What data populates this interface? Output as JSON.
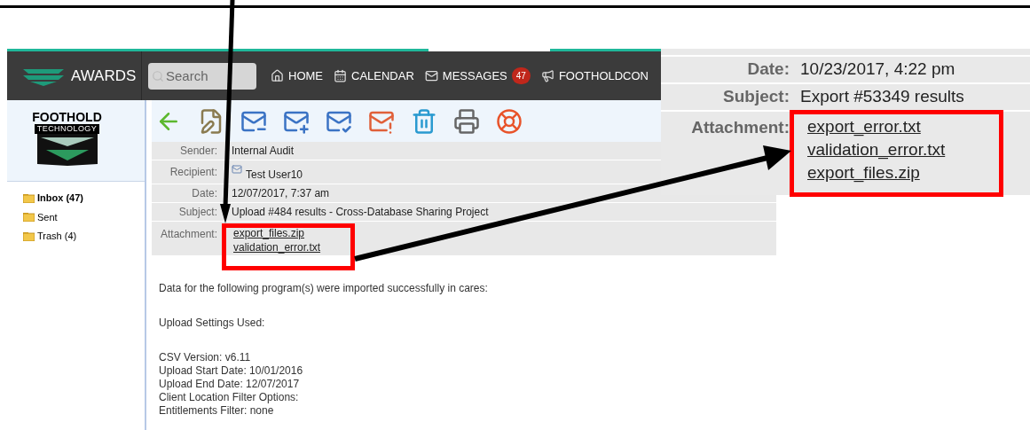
{
  "nav": {
    "brand": "AWARDS",
    "search": {
      "placeholder": "Search"
    },
    "items": [
      {
        "kind": "home",
        "label": "HOME"
      },
      {
        "kind": "calendar",
        "label": "CALENDAR"
      },
      {
        "kind": "messages",
        "label": "MESSAGES",
        "badge": "47"
      },
      {
        "kind": "megaphone",
        "label": "FOOTHOLDCON"
      }
    ]
  },
  "sidebar": {
    "logo": {
      "line1": "FOOTHOLD",
      "line2": "TECHNOLOGY"
    },
    "folders": [
      {
        "label": "Inbox (47)",
        "unread": true
      },
      {
        "label": "Sent",
        "unread": false
      },
      {
        "label": "Trash (4)",
        "unread": false
      }
    ]
  },
  "message": {
    "fields": [
      {
        "kind": "text",
        "label": "Sender:",
        "value": "Internal Audit"
      },
      {
        "kind": "recipient",
        "label": "Recipient:",
        "value": "Test User10"
      },
      {
        "kind": "text",
        "label": "Date:",
        "value": "12/07/2017, 7:37 am"
      },
      {
        "kind": "text",
        "label": "Subject:",
        "value": "Upload #484 results - Cross-Database Sharing Project"
      }
    ],
    "attachment_label": "Attachment:",
    "attachments": [
      "export_files.zip",
      "validation_error.txt"
    ],
    "body": [
      [
        "Data for the following program(s) were imported successfully in cares:"
      ],
      [
        "Upload Settings Used:"
      ],
      [
        "CSV Version: v6.11",
        "Upload Start Date: 10/01/2016",
        "Upload End Date: 12/07/2017",
        "Client Location Filter Options:",
        "Entitlements Filter: none"
      ]
    ]
  },
  "inset": {
    "fields": [
      {
        "label": "Date:",
        "value": "10/23/2017, 4:22 pm"
      },
      {
        "label": "Subject:",
        "value": "Export #53349 results"
      }
    ],
    "attachment_label": "Attachment:",
    "attachments": [
      "export_error.txt",
      "validation_error.txt",
      "export_files.zip"
    ]
  }
}
